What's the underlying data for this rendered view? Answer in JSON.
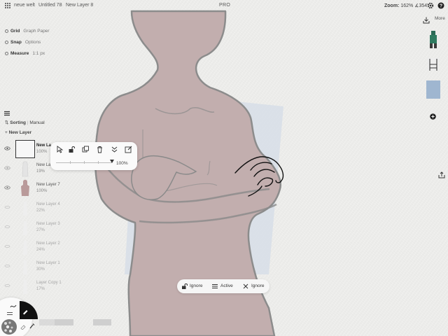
{
  "topbar": {
    "breadcrumbs": [
      "neue welt",
      "Untitled 78",
      "New Layer 8"
    ],
    "app_title": "PRO",
    "zoom_label": "Zoom:",
    "zoom_value": "162% ∡354°"
  },
  "canvas_options": [
    {
      "label": "Grid",
      "value": "Graph Paper"
    },
    {
      "label": "Snap",
      "value": "Options"
    },
    {
      "label": "Measure",
      "value": "1:1 px"
    }
  ],
  "layers_panel": {
    "sorting_label": "Sorting",
    "sorting_value": "Manual",
    "new_layer_label": "New Layer",
    "layers": [
      {
        "name": "New La",
        "opacity": "100%",
        "visible": true,
        "selected": true
      },
      {
        "name": "New La",
        "opacity": "19%",
        "visible": true,
        "selected": false
      },
      {
        "name": "New Layer 7",
        "opacity": "100%",
        "visible": true,
        "selected": false
      },
      {
        "name": "New Layer 4",
        "opacity": "22%",
        "visible": false,
        "selected": false
      },
      {
        "name": "New Layer 3",
        "opacity": "27%",
        "visible": false,
        "selected": false
      },
      {
        "name": "New Layer 2",
        "opacity": "24%",
        "visible": false,
        "selected": false
      },
      {
        "name": "New Layer 1",
        "opacity": "30%",
        "visible": false,
        "selected": false
      },
      {
        "name": "Layer Copy 1",
        "opacity": "17%",
        "visible": false,
        "selected": false
      }
    ]
  },
  "layer_popover": {
    "icons": [
      "select-icon",
      "unlock-icon",
      "duplicate-icon",
      "trash-icon",
      "merge-down-icon",
      "edit-icon"
    ],
    "opacity_value": "100%",
    "opacity_fraction": 1.0
  },
  "bottom_pill": {
    "lock_label": "Ignore",
    "blend_label": "Active",
    "mask_label": "Ignore"
  },
  "right_sidebar": {
    "more_label": "More",
    "swatch_colors": [
      "#9fb6d0"
    ]
  },
  "colors": {
    "figure_fill": "#c2aeae",
    "figure_stroke": "#8c8c8c",
    "selection_rect": "#d7dee8",
    "popover_bg": "#fafafa",
    "pill_bg": "#f6f6f6"
  }
}
